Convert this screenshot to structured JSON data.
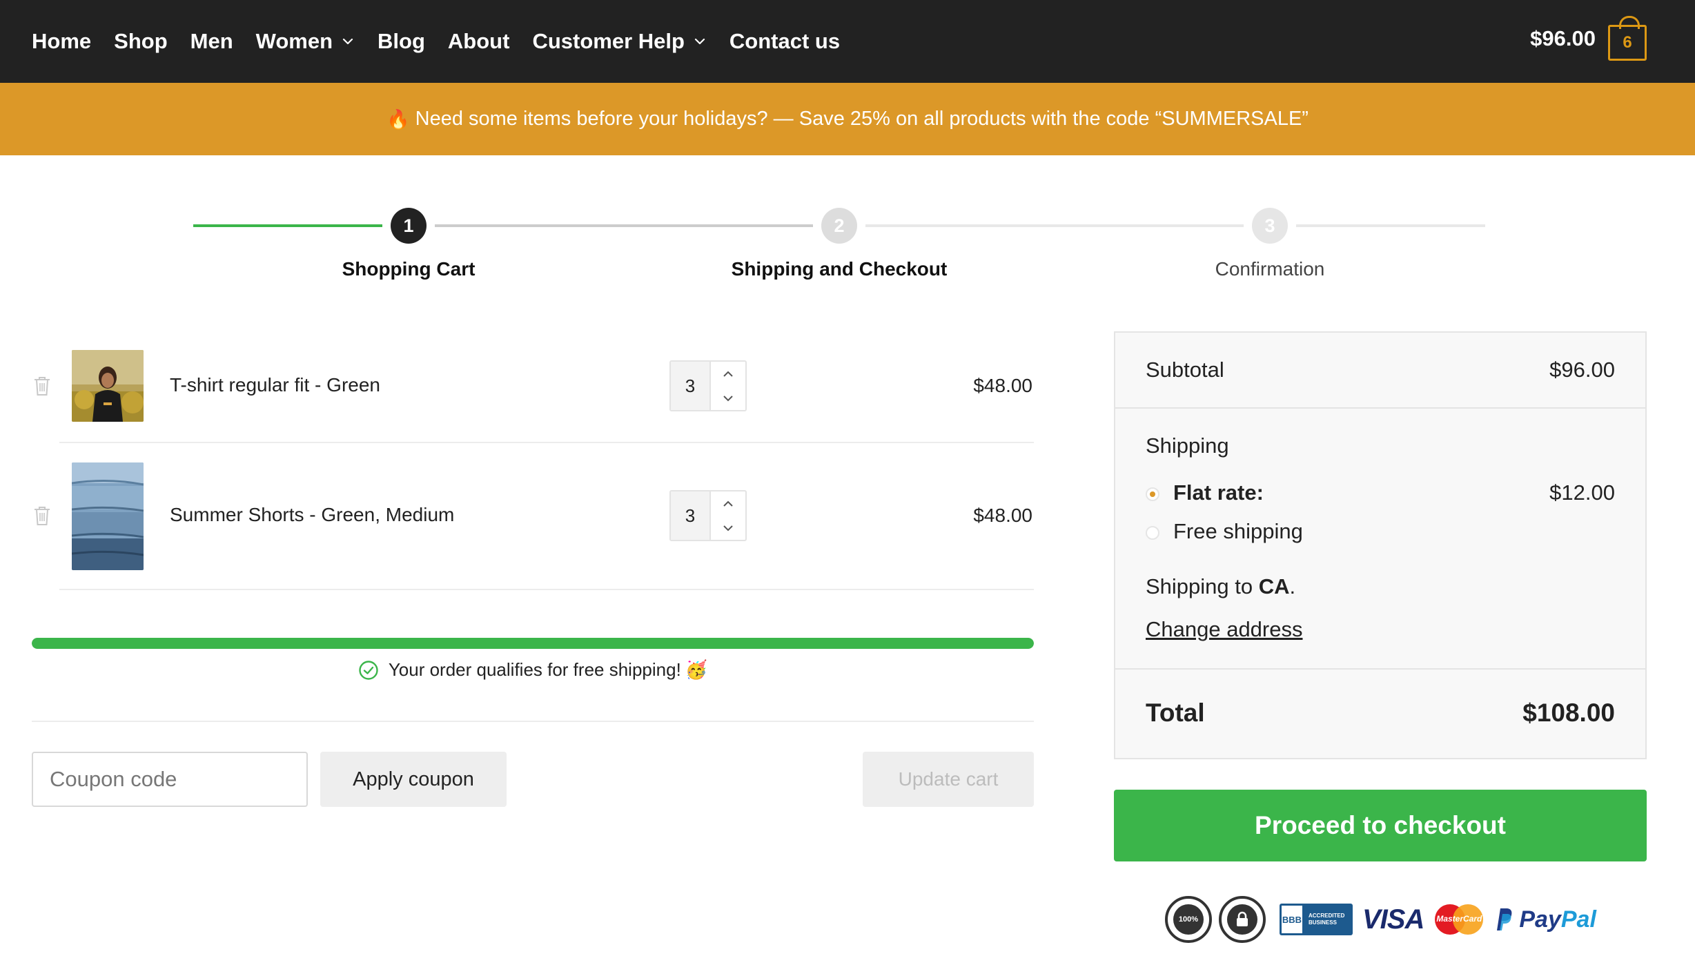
{
  "header": {
    "nav": [
      {
        "label": "Home",
        "has_dropdown": false
      },
      {
        "label": "Shop",
        "has_dropdown": false
      },
      {
        "label": "Men",
        "has_dropdown": false
      },
      {
        "label": "Women",
        "has_dropdown": true
      },
      {
        "label": "Blog",
        "has_dropdown": false
      },
      {
        "label": "About",
        "has_dropdown": false
      },
      {
        "label": "Customer Help",
        "has_dropdown": true
      },
      {
        "label": "Contact us",
        "has_dropdown": false
      }
    ],
    "cart_total": "$96.00",
    "cart_count": "6"
  },
  "promo": {
    "icon": "fire-icon",
    "text": "Need some items before your holidays? — Save 25% on all products with the code “SUMMERSALE”"
  },
  "steps": [
    {
      "number": "1",
      "label": "Shopping Cart",
      "state": "active"
    },
    {
      "number": "2",
      "label": "Shipping and Checkout",
      "state": "upcoming"
    },
    {
      "number": "3",
      "label": "Confirmation",
      "state": "upcoming"
    }
  ],
  "cart": {
    "items": [
      {
        "name": "T-shirt regular fit - Green",
        "quantity": "3",
        "price": "$48.00"
      },
      {
        "name": "Summer Shorts - Green, Medium",
        "quantity": "3",
        "price": "$48.00"
      }
    ],
    "free_shipping_progress": 1.0,
    "free_shipping_message": "Your order qualifies for free shipping!",
    "free_shipping_emoji": "🥳",
    "coupon_placeholder": "Coupon code",
    "apply_coupon_label": "Apply coupon",
    "update_cart_label": "Update cart"
  },
  "totals": {
    "subtotal_label": "Subtotal",
    "subtotal_value": "$96.00",
    "shipping_label": "Shipping",
    "shipping_options": [
      {
        "label": "Flat rate:",
        "price": "$12.00",
        "selected": true
      },
      {
        "label": "Free shipping",
        "price": "",
        "selected": false
      }
    ],
    "shipping_to_prefix": "Shipping to",
    "shipping_to_region": "CA",
    "shipping_to_suffix": ".",
    "change_address_label": "Change address",
    "total_label": "Total",
    "total_value": "$108.00",
    "checkout_label": "Proceed to checkout"
  },
  "trust_badges": {
    "seal_satisfaction": "100%",
    "bbb_lines": [
      "ACCREDITED",
      "BUSINESS"
    ],
    "bbb_mark": "BBB",
    "visa": "VISA",
    "mastercard": "MasterCard",
    "paypal_1": "Pay",
    "paypal_2": "Pal"
  },
  "colors": {
    "header_bg": "#222222",
    "promo_bg": "#dc9828",
    "accent_green": "#3bb54a",
    "accent_orange": "#dc9814"
  }
}
